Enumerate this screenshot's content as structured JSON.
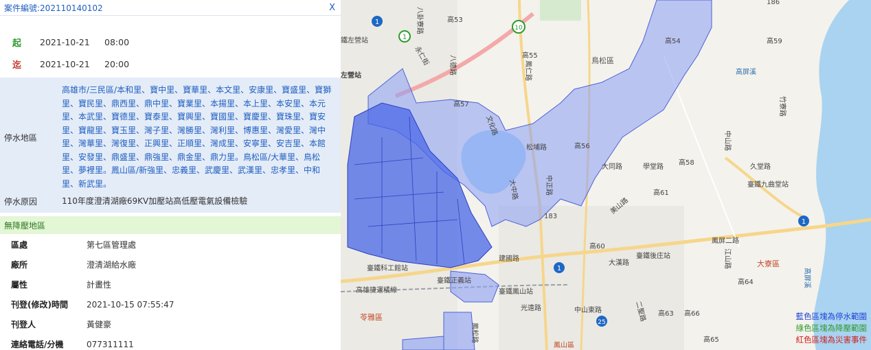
{
  "panel": {
    "case_label": "案件編號:202110140102",
    "close_label": "X",
    "start": {
      "key": "起",
      "date": "2021-10-21",
      "time": "08:00"
    },
    "end": {
      "key": "迄",
      "date": "2021-10-21",
      "time": "20:00"
    },
    "area_key": "停水地區",
    "area_text": "高雄市/三民區/本和里、寶中里、寶華里、本文里、安康里、寶盛里、寶獅里、寶民里、鼎西里、鼎中里、寶業里、本揚里、本上里、本安里、本元里、本武里、寶德里、寶泰里、寶興里、寶國里、寶慶里、寶珠里、寶安里、寶龍里、寶玉里、灣子里、灣勝里、灣利里、博惠里、灣愛里、灣中里、灣華里、灣復里、正興里、正順里、灣成里、安寧里、安吉里、本館里、安發里、鼎盛里、鼎強里、鼎金里、鼎力里。鳥松區/大華里、鳥松里、夢裡里。鳳山區/新強里、忠義里、武慶里、武漢里、忠孝里、中和里、新武里。",
    "reason_key": "停水原因",
    "reason_text": "110年度澄清湖廠69KV加壓站高低壓電氣設備檢驗",
    "section_title": "無降壓地區",
    "details": [
      {
        "key": "區處",
        "value": "第七區管理處"
      },
      {
        "key": "廠所",
        "value": "澄清湖給水廠"
      },
      {
        "key": "屬性",
        "value": "計畫性"
      },
      {
        "key": "刊登(修改)時間",
        "value": "2021-10-15 07:55:47"
      },
      {
        "key": "刊登人",
        "value": "黃健豪"
      },
      {
        "key": "連絡電話/分機",
        "value": "077311111"
      }
    ]
  },
  "map": {
    "labels": {
      "zuoying_hsr": "鐵左營站",
      "zuoying_station": "左營站",
      "baguachu": "八卦寮路",
      "yongren": "永仁街",
      "bagua": "八德路",
      "fengren": "鳳仁路",
      "wenzhi": "文化路",
      "kao53": "高53",
      "kao55": "高55",
      "kao57": "高57",
      "niaosong_dist": "鳥松區",
      "kao54": "高54",
      "kao59": "高59",
      "shuangpu": "松埔路",
      "kao56": "高56",
      "datong": "大同路",
      "xuetang": "學堂路",
      "kao58": "高58",
      "jiutang": "久堂路",
      "jiuqutang_station": "臺鐵九曲堂站",
      "gaopingxi": "高屏溪",
      "zhongshan": "中山路",
      "zhuya": "竹寮路",
      "kao61": "高61",
      "zhongzheng": "中正路",
      "dazhong": "大中路",
      "route183": "183",
      "kao60": "高60",
      "meishan": "美山路",
      "houzhuang_station": "臺鐵後庄站",
      "fengping2": "鳳屏二路",
      "jiangshan": "江山路",
      "daliao": "大寮區",
      "kao64": "高64",
      "gaopingxi2": "高屏溪",
      "jianguo": "建國路",
      "kezhuang_station": "臺鐵科工館站",
      "zhengyi_station": "臺鐵正義站",
      "fengshan_station": "臺鐵鳳山站",
      "dongfeng": "大漢路",
      "lingya": "苓雅區",
      "kaohsiung_line": "高雄捷運橘線",
      "guangyuan": "光遠路",
      "zhongshan_east": "中山東路",
      "kao63": "高63",
      "kao66": "高66",
      "kao65": "高65",
      "fengshan_dist": "鳳山區",
      "wusong": "鳳松路",
      "ershi": "二聖路",
      "route1a": "1",
      "route1b": "1",
      "route10": "10",
      "route1c": "1",
      "route1d": "1",
      "route25": "25",
      "route186": "186"
    },
    "legend": [
      {
        "text": "藍色區塊為停水範圍",
        "color": "#1f43d8"
      },
      {
        "text": "綠色區塊為降壓範圍",
        "color": "#2e9a2e"
      },
      {
        "text": "紅色區塊為災害事件",
        "color": "#d02020"
      }
    ]
  }
}
